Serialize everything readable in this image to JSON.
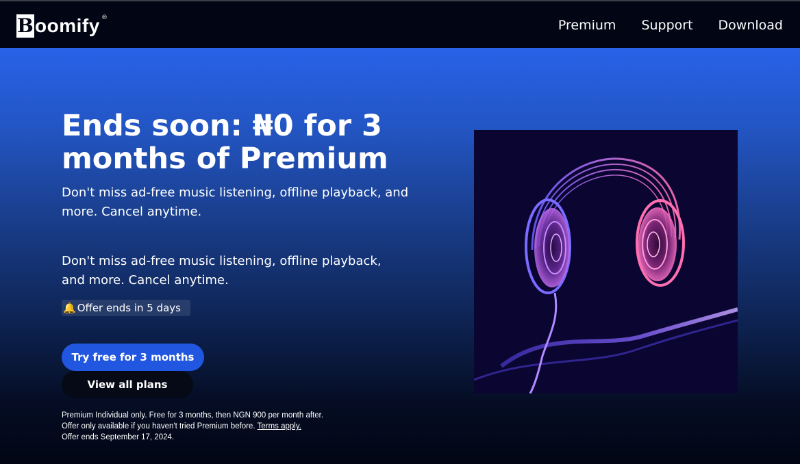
{
  "brand": {
    "name": "oomify",
    "mark": "B",
    "registered": "®"
  },
  "nav": {
    "items": [
      "Premium",
      "Support",
      "Download"
    ]
  },
  "hero": {
    "headline": "Ends soon: ₦0 for 3 months of Premium",
    "subtitle_1": "Don't miss ad-free music listening, offline playback, and more. Cancel anytime.",
    "subtitle_2": "Don't miss ad-free music listening, offline playback, and more. Cancel anytime.",
    "offer_badge": {
      "icon": "bell-icon",
      "text": "Offer ends in 5 days"
    },
    "primary_button": "Try free for 3 months",
    "secondary_button": "View all plans",
    "fine_print": {
      "line_1": "Premium Individual only. Free for 3 months, then NGN 900 per month after.",
      "line_2": "Offer only available if you haven't tried Premium before.",
      "terms_link": "Terms apply.",
      "line_3": "Offer ends September 17, 2024."
    },
    "image": {
      "subject": "headphones-illustration"
    }
  },
  "colors": {
    "header_bg": "#020614",
    "hero_top": "#2862e8",
    "hero_bottom": "#020614",
    "primary_button": "#2157e0",
    "secondary_button": "#050a16",
    "badge_icon": "#f5b400"
  }
}
